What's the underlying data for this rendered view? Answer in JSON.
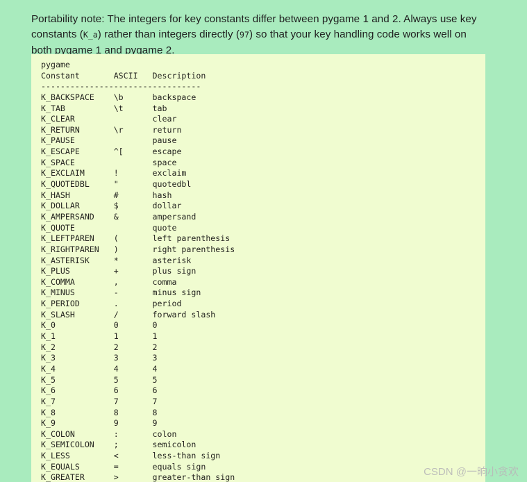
{
  "note": {
    "segment_1": "Portability note: The integers for key constants differ between pygame 1 and 2. Always use key constants (",
    "code_1": "K_a",
    "segment_2": ") rather than integers directly (",
    "code_2": "97",
    "segment_3": ") so that your key handling code works well on both pygame 1 and pygame 2."
  },
  "codeblock": {
    "title_line": "pygame",
    "headers": {
      "constant": "Constant",
      "ascii": "ASCII",
      "description": "Description"
    },
    "separator": "---------------------------------",
    "column_widths": {
      "constant": 15,
      "ascii": 8
    },
    "rows": [
      {
        "constant": "K_BACKSPACE",
        "ascii": "\\b",
        "description": "backspace"
      },
      {
        "constant": "K_TAB",
        "ascii": "\\t",
        "description": "tab"
      },
      {
        "constant": "K_CLEAR",
        "ascii": "",
        "description": "clear"
      },
      {
        "constant": "K_RETURN",
        "ascii": "\\r",
        "description": "return"
      },
      {
        "constant": "K_PAUSE",
        "ascii": "",
        "description": "pause"
      },
      {
        "constant": "K_ESCAPE",
        "ascii": "^[",
        "description": "escape"
      },
      {
        "constant": "K_SPACE",
        "ascii": "",
        "description": "space"
      },
      {
        "constant": "K_EXCLAIM",
        "ascii": "!",
        "description": "exclaim"
      },
      {
        "constant": "K_QUOTEDBL",
        "ascii": "\"",
        "description": "quotedbl"
      },
      {
        "constant": "K_HASH",
        "ascii": "#",
        "description": "hash"
      },
      {
        "constant": "K_DOLLAR",
        "ascii": "$",
        "description": "dollar"
      },
      {
        "constant": "K_AMPERSAND",
        "ascii": "&",
        "description": "ampersand"
      },
      {
        "constant": "K_QUOTE",
        "ascii": "",
        "description": "quote"
      },
      {
        "constant": "K_LEFTPAREN",
        "ascii": "(",
        "description": "left parenthesis"
      },
      {
        "constant": "K_RIGHTPAREN",
        "ascii": ")",
        "description": "right parenthesis"
      },
      {
        "constant": "K_ASTERISK",
        "ascii": "*",
        "description": "asterisk"
      },
      {
        "constant": "K_PLUS",
        "ascii": "+",
        "description": "plus sign"
      },
      {
        "constant": "K_COMMA",
        "ascii": ",",
        "description": "comma"
      },
      {
        "constant": "K_MINUS",
        "ascii": "-",
        "description": "minus sign"
      },
      {
        "constant": "K_PERIOD",
        "ascii": ".",
        "description": "period"
      },
      {
        "constant": "K_SLASH",
        "ascii": "/",
        "description": "forward slash"
      },
      {
        "constant": "K_0",
        "ascii": "0",
        "description": "0"
      },
      {
        "constant": "K_1",
        "ascii": "1",
        "description": "1"
      },
      {
        "constant": "K_2",
        "ascii": "2",
        "description": "2"
      },
      {
        "constant": "K_3",
        "ascii": "3",
        "description": "3"
      },
      {
        "constant": "K_4",
        "ascii": "4",
        "description": "4"
      },
      {
        "constant": "K_5",
        "ascii": "5",
        "description": "5"
      },
      {
        "constant": "K_6",
        "ascii": "6",
        "description": "6"
      },
      {
        "constant": "K_7",
        "ascii": "7",
        "description": "7"
      },
      {
        "constant": "K_8",
        "ascii": "8",
        "description": "8"
      },
      {
        "constant": "K_9",
        "ascii": "9",
        "description": "9"
      },
      {
        "constant": "K_COLON",
        "ascii": ":",
        "description": "colon"
      },
      {
        "constant": "K_SEMICOLON",
        "ascii": ";",
        "description": "semicolon"
      },
      {
        "constant": "K_LESS",
        "ascii": "<",
        "description": "less-than sign"
      },
      {
        "constant": "K_EQUALS",
        "ascii": "=",
        "description": "equals sign"
      },
      {
        "constant": "K_GREATER",
        "ascii": ">",
        "description": "greater-than sign"
      }
    ]
  },
  "watermark": {
    "text": "CSDN @一晌小贪欢"
  },
  "colors": {
    "page_background": "#a9ebbe",
    "code_background": "#f0fcd0",
    "text": "#1f1f1f",
    "code_text": "#23241f",
    "watermark": "#b9b9b9"
  }
}
